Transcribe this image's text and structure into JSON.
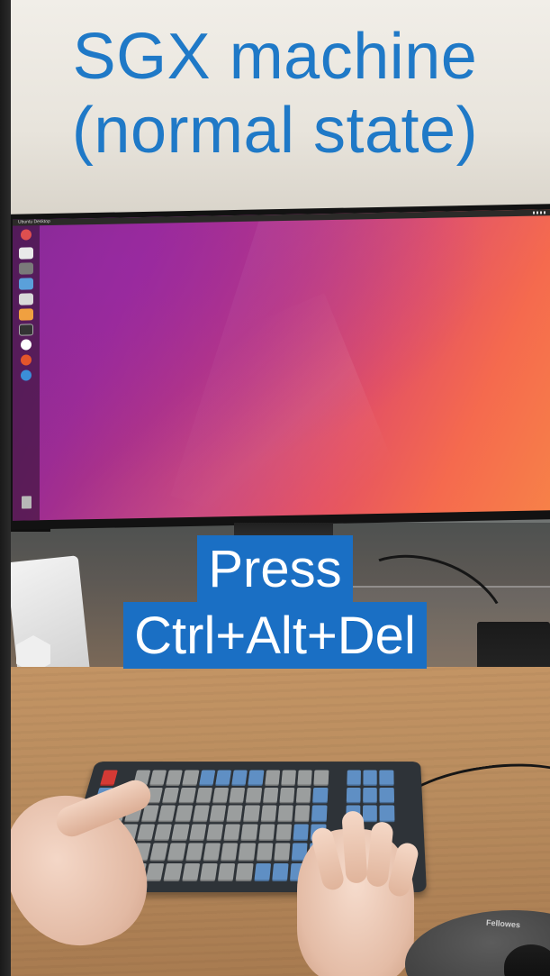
{
  "title": {
    "line1": "SGX machine",
    "line2": "(normal state)"
  },
  "caption": {
    "line1": "Press",
    "line2": "Ctrl+Alt+Del"
  },
  "desktop": {
    "topbar_label": "Ubuntu Desktop",
    "launcher_icons": [
      "ubuntu-icon",
      "files-icon",
      "terminal-icon",
      "browser-icon",
      "text-editor-icon",
      "software-icon",
      "terminal-icon",
      "settings-icon",
      "ubuntu-one-icon",
      "chrome-icon"
    ],
    "trash": "trash-icon"
  },
  "scene": {
    "mousepad_brand": "Fellowes",
    "accent_color": "#1f79c7",
    "caption_bg_color": "#1a6fc4"
  }
}
